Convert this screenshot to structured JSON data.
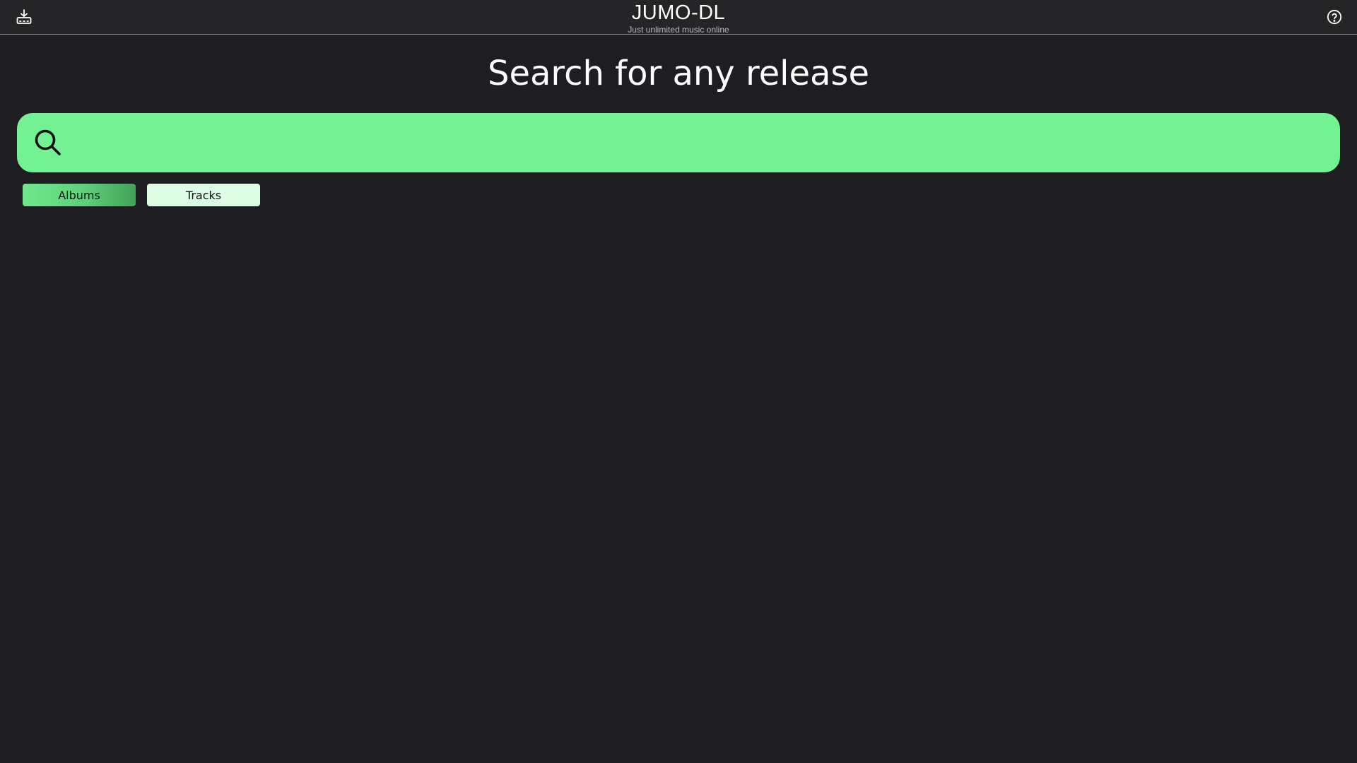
{
  "header": {
    "title": "JUMO-DL",
    "subtitle": "Just unlimited music online",
    "left_icon": "download-icon",
    "right_icon": "help-icon"
  },
  "main": {
    "heading": "Search for any release",
    "search": {
      "value": "",
      "placeholder": "",
      "icon": "search-icon"
    },
    "filters": [
      {
        "label": "Albums",
        "selected": true
      },
      {
        "label": "Tracks",
        "selected": false
      }
    ]
  },
  "colors": {
    "background": "#1e1e22",
    "header_background": "#252528",
    "accent": "#72f292",
    "selected_filter": "#5fd07a",
    "unselected_filter": "#dcfde3"
  }
}
